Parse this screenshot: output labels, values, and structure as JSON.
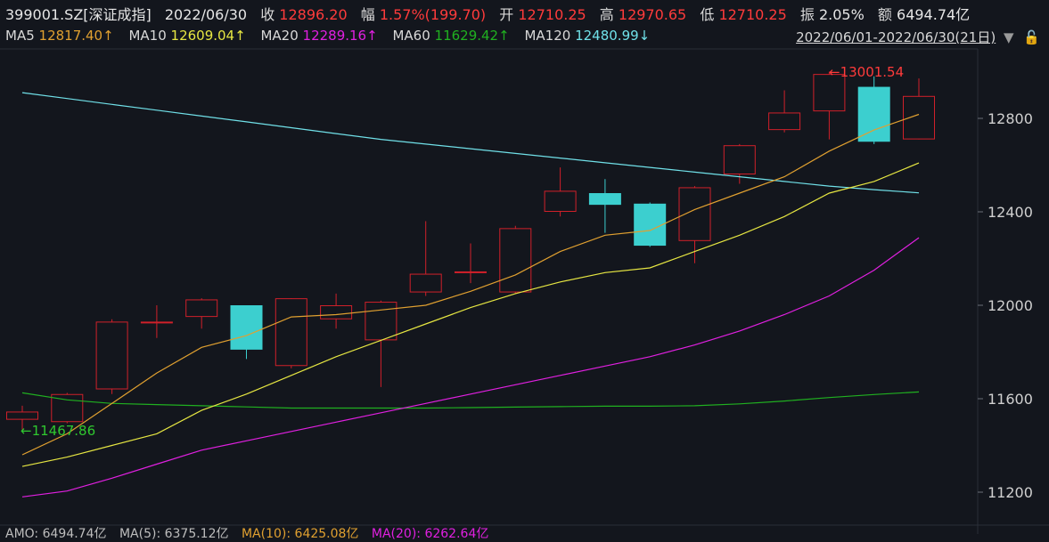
{
  "header": {
    "code": "399001.SZ[深证成指]",
    "date": "2022/06/30",
    "close_label": "收",
    "close": "12896.20",
    "chg_label": "幅",
    "chg": "1.57%(199.70)",
    "open_label": "开",
    "open": "12710.25",
    "high_label": "高",
    "high": "12970.65",
    "low_label": "低",
    "low": "12710.25",
    "amp_label": "振",
    "amp": "2.05%",
    "amount_label": "额",
    "amount": "6494.74亿"
  },
  "ma_bar": {
    "ma5_label": "MA5",
    "ma5": "12817.40↑",
    "ma10_label": "MA10",
    "ma10": "12609.04↑",
    "ma20_label": "MA20",
    "ma20": "12289.16↑",
    "ma60_label": "MA60",
    "ma60": "11629.42↑",
    "ma120_label": "MA120",
    "ma120": "12480.99↓",
    "range_text": "2022/06/01-2022/06/30(21日)",
    "dropdown_icon": "triangle-down",
    "lock_icon": "lock"
  },
  "bottom_bar": {
    "amo": "AMO: 6494.74亿",
    "ma5": "MA(5): 6375.12亿",
    "ma10": "MA(10): 6425.08亿",
    "ma20": "MA(20): 6262.64亿"
  },
  "colors": {
    "up": "#d0202a",
    "down": "#3ccfcf",
    "ma5": "#e0a030",
    "ma10": "#e6e642",
    "ma20": "#e020e0",
    "ma60": "#20b020",
    "ma120": "#70e0e8",
    "axis": "#2a2e38"
  },
  "chart_data": {
    "type": "candlestick",
    "ylim": [
      11060,
      13200
    ],
    "yticks": [
      "12800",
      "12400",
      "12000",
      "11600",
      "11200"
    ],
    "high_annotation": "←13001.54",
    "low_annotation": "←11467.86",
    "candles": [
      {
        "o": 11510,
        "h": 11570,
        "l": 11468,
        "c": 11545
      },
      {
        "o": 11500,
        "h": 11625,
        "l": 11495,
        "c": 11620
      },
      {
        "o": 11640,
        "h": 11940,
        "l": 11620,
        "c": 11930
      },
      {
        "o": 11930,
        "h": 12000,
        "l": 11860,
        "c": 11930
      },
      {
        "o": 11950,
        "h": 12030,
        "l": 11900,
        "c": 12025
      },
      {
        "o": 12000,
        "h": 12000,
        "l": 11770,
        "c": 11810
      },
      {
        "o": 11740,
        "h": 12030,
        "l": 11730,
        "c": 12030
      },
      {
        "o": 11940,
        "h": 12050,
        "l": 11900,
        "c": 12000
      },
      {
        "o": 11850,
        "h": 12020,
        "l": 11650,
        "c": 12015
      },
      {
        "o": 12055,
        "h": 12360,
        "l": 12040,
        "c": 12135
      },
      {
        "o": 12145,
        "h": 12265,
        "l": 12095,
        "c": 12145
      },
      {
        "o": 12055,
        "h": 12340,
        "l": 12050,
        "c": 12330
      },
      {
        "o": 12400,
        "h": 12590,
        "l": 12380,
        "c": 12490
      },
      {
        "o": 12480,
        "h": 12540,
        "l": 12310,
        "c": 12430
      },
      {
        "o": 12435,
        "h": 12440,
        "l": 12250,
        "c": 12255
      },
      {
        "o": 12275,
        "h": 12510,
        "l": 12180,
        "c": 12505
      },
      {
        "o": 12560,
        "h": 12690,
        "l": 12520,
        "c": 12685
      },
      {
        "o": 12750,
        "h": 12920,
        "l": 12740,
        "c": 12825
      },
      {
        "o": 12830,
        "h": 13000,
        "l": 12710,
        "c": 12990
      },
      {
        "o": 12935,
        "h": 12980,
        "l": 12690,
        "c": 12700
      },
      {
        "o": 12710,
        "h": 12971,
        "l": 12710,
        "c": 12896
      }
    ],
    "ma5": [
      11360,
      11450,
      11580,
      11710,
      11820,
      11870,
      11950,
      11960,
      11980,
      12000,
      12060,
      12130,
      12230,
      12300,
      12320,
      12410,
      12480,
      12550,
      12660,
      12750,
      12817
    ],
    "ma10": [
      11310,
      11350,
      11400,
      11450,
      11550,
      11620,
      11700,
      11780,
      11850,
      11920,
      11990,
      12050,
      12100,
      12140,
      12160,
      12230,
      12300,
      12380,
      12480,
      12530,
      12609
    ],
    "ma20": [
      11180,
      11205,
      11260,
      11320,
      11380,
      11420,
      11460,
      11500,
      11540,
      11580,
      11620,
      11660,
      11700,
      11740,
      11780,
      11830,
      11890,
      11960,
      12040,
      12150,
      12289
    ],
    "ma60": [
      11625,
      11595,
      11580,
      11575,
      11570,
      11565,
      11560,
      11560,
      11560,
      11560,
      11562,
      11564,
      11566,
      11568,
      11568,
      11570,
      11578,
      11590,
      11605,
      11618,
      11629
    ],
    "ma120": [
      12910,
      12885,
      12860,
      12835,
      12810,
      12785,
      12760,
      12735,
      12710,
      12690,
      12670,
      12650,
      12630,
      12610,
      12590,
      12570,
      12550,
      12530,
      12510,
      12495,
      12481
    ]
  }
}
